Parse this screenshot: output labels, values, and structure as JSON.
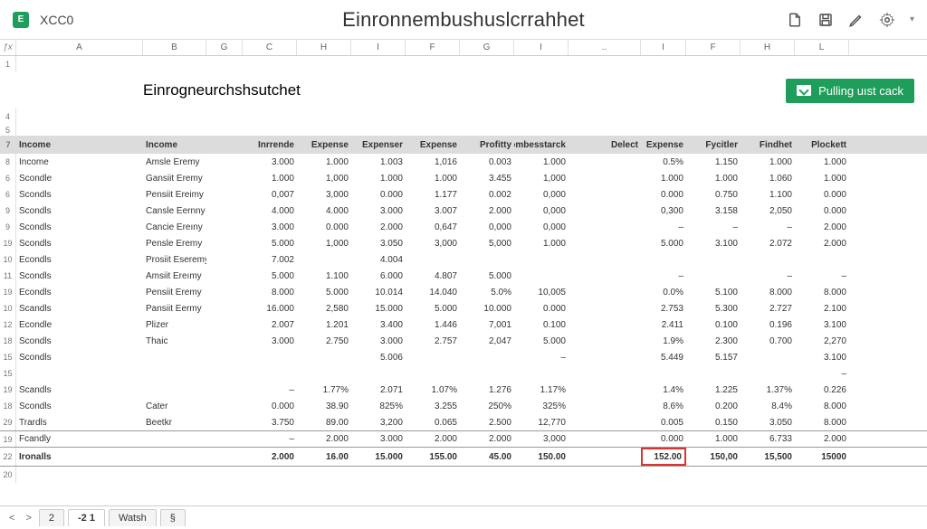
{
  "app_icon_letter": "E",
  "file_name": "XCC0",
  "title_center": "Einronnembushuslcrrahhet",
  "inner_title": "Einrogneurchshsutchet",
  "green_button_label": "Pulling uıst cack",
  "col_headers": [
    "A",
    "B",
    "G",
    "C",
    "H",
    "I",
    "F",
    "G",
    "I",
    "..",
    "I",
    "F",
    "H",
    "L"
  ],
  "table_header": {
    "a": "Income",
    "b": "Income",
    "d": "Inrrende",
    "e": "Expense",
    "f": "Expenser",
    "g": "Expense",
    "h": "Profitty",
    "i": "Enpombesstarck",
    "j": "Delect",
    "k": "Expense",
    "l": "Fycitler",
    "m": "Findhet",
    "n": "Plockett"
  },
  "rows": [
    {
      "rn": "8",
      "a": "Income",
      "b": "Amsle Eremy",
      "d": "3.000",
      "e": "1.000",
      "f": "1.003",
      "g": "1,016",
      "h": "0.003",
      "i": "1.000",
      "k": "0.5%",
      "l": "1.150",
      "m": "1.000",
      "n": "1.000"
    },
    {
      "rn": "6",
      "a": "Scondle",
      "b": "Gansiit Eremy",
      "d": "1.000",
      "e": "1,000",
      "f": "1.000",
      "g": "1.000",
      "h": "3.455",
      "i": "1,000",
      "k": "1.000",
      "l": "1.000",
      "m": "1.060",
      "n": "1.000"
    },
    {
      "rn": "6",
      "a": "Scondls",
      "b": "Pensiit Ereimy",
      "d": "0,007",
      "e": "3,000",
      "f": "0.000",
      "g": "1.177",
      "h": "0.002",
      "i": "0,000",
      "k": "0.000",
      "l": "0.750",
      "m": "1.100",
      "n": "0.000"
    },
    {
      "rn": "9",
      "a": "Scondls",
      "b": "Cansle Eernny",
      "d": "4.000",
      "e": "4.000",
      "f": "3.000",
      "g": "3.007",
      "h": "2.000",
      "i": "0,000",
      "k": "0,300",
      "l": "3.158",
      "m": "2,050",
      "n": "0.000"
    },
    {
      "rn": "9",
      "a": "Scondls",
      "b": "Cancie Ereıny",
      "d": "3.000",
      "e": "0.000",
      "f": "2.000",
      "g": "0,647",
      "h": "0,000",
      "i": "0,000",
      "k": "–",
      "l": "–",
      "m": "–",
      "n": "2.000"
    },
    {
      "rn": "19",
      "a": "Scondls",
      "b": "Pensle Eremy",
      "d": "5.000",
      "e": "1,000",
      "f": "3.050",
      "g": "3,000",
      "h": "5,000",
      "i": "1.000",
      "k": "5.000",
      "l": "3.100",
      "m": "2.072",
      "n": "2.000"
    },
    {
      "rn": "10",
      "a": "Econdls",
      "b": "Prosiit Eseremy",
      "d": "7.002",
      "f": "4.004"
    },
    {
      "rn": "11",
      "a": "Scondls",
      "b": "Amsiit Ereımy",
      "d": "5.000",
      "e": "1.100",
      "f": "6.000",
      "g": "4.807",
      "h": "5.000",
      "k": "–",
      "l": "",
      "m": "–",
      "n": "–"
    },
    {
      "rn": "19",
      "a": "Econdls",
      "b": "Pensiit Eremy",
      "d": "8.000",
      "e": "5.000",
      "f": "10.014",
      "g": "14.040",
      "h": "5.0%",
      "i": "10,005",
      "k": "0.0%",
      "l": "5.100",
      "m": "8.000",
      "n": "8.000"
    },
    {
      "rn": "10",
      "a": "Scandls",
      "b": "Pansiit Eermy",
      "d": "16.000",
      "e": "2,580",
      "f": "15.000",
      "g": "5.000",
      "h": "10.000",
      "i": "0.000",
      "k": "2.753",
      "l": "5.300",
      "m": "2.727",
      "n": "2.100"
    },
    {
      "rn": "12",
      "a": "Econdle",
      "b": "Plizer",
      "d": "2.007",
      "e": "1.201",
      "f": "3.400",
      "g": "1.446",
      "h": "7,001",
      "i": "0.100",
      "k": "2.411",
      "l": "0.100",
      "m": "0.196",
      "n": "3.100"
    },
    {
      "rn": "18",
      "a": "Scondls",
      "b": "Thaic",
      "d": "3.000",
      "e": "2.750",
      "f": "3.000",
      "g": "2.757",
      "h": "2,047",
      "i": "5.000",
      "k": "1.9%",
      "l": "2.300",
      "m": "0.700",
      "n": "2,270"
    },
    {
      "rn": "15",
      "a": "Scondls",
      "f": "5.006",
      "i": "–",
      "k": "5.449",
      "l": "5.157",
      "n": "3.100"
    },
    {
      "rn": "15",
      "n": "–"
    },
    {
      "rn": "19",
      "a": "Scandls",
      "d": "–",
      "e": "1.77%",
      "f": "2.071",
      "g": "1.07%",
      "h": "1.276",
      "i": "1.17%",
      "k": "1.4%",
      "l": "1.225",
      "m": "1.37%",
      "n": "0.226"
    },
    {
      "rn": "18",
      "a": "Scondls",
      "b": "Cater",
      "d": "0.000",
      "e": "38.90",
      "f": "825%",
      "g": "3.255",
      "h": "250%",
      "i": "325%",
      "k": "8.6%",
      "l": "0.200",
      "m": "8.4%",
      "n": "8.000"
    },
    {
      "rn": "29",
      "a": "Trardls",
      "b": "Beetkr",
      "d": "3.750",
      "e": "89.00",
      "f": "3,200",
      "g": "0.065",
      "h": "2.500",
      "i": "12,770",
      "k": "0.005",
      "l": "0.150",
      "m": "3.050",
      "n": "8.000"
    },
    {
      "rn": "19",
      "a": "Fcandly",
      "d": "–",
      "e": "2.000",
      "f": "3.000",
      "g": "2.000",
      "h": "2.000",
      "i": "3,000",
      "k": "0.000",
      "l": "1.000",
      "m": "6.733",
      "n": "2.000"
    }
  ],
  "total_row": {
    "rn": "22",
    "a": "Ironalls",
    "d": "2.000",
    "e": "16.00",
    "f": "15.000",
    "g": "155.00",
    "h": "45.00",
    "i": "150.00",
    "k": "152.00",
    "l": "150,00",
    "m": "15,500",
    "n": "15000"
  },
  "sheet_tabs": {
    "nav_prev": "<",
    "nav_next": ">",
    "tab1": "2",
    "tab2_active": "-2 1",
    "tab3": "Watsh",
    "tab4": "§"
  }
}
